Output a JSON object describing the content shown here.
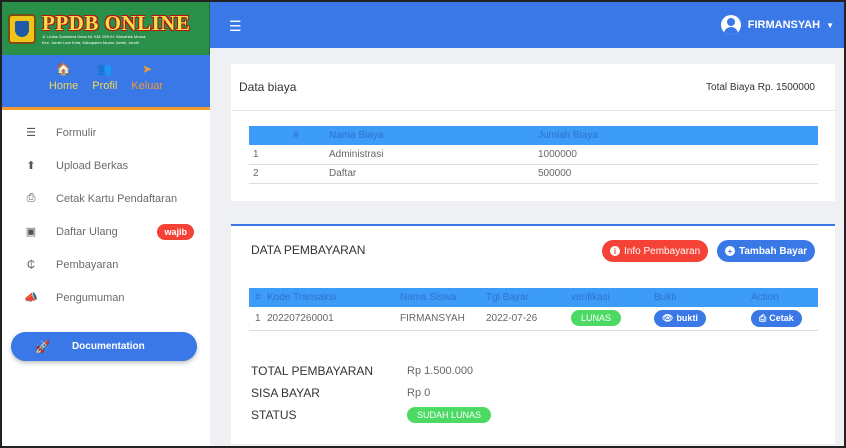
{
  "brand": {
    "title": "PPDB ONLINE",
    "subtitle_line1": "Jl. Lintas Sumatera Desa Nt. KM. 009 Kt. Wanahita Muara,",
    "subtitle_line2": "Kec. Jambi Luar Kota, Kabupaten Muaro Jambi, Jambi"
  },
  "userbar": {
    "home": "Home",
    "profil": "Profil",
    "keluar": "Keluar"
  },
  "sidebar": {
    "items": [
      {
        "label": "Formulir",
        "icon": "list-icon"
      },
      {
        "label": "Upload Berkas",
        "icon": "upload-icon"
      },
      {
        "label": "Cetak Kartu Pendaftaran",
        "icon": "print-icon"
      },
      {
        "label": "Daftar Ulang",
        "icon": "id-card-icon",
        "badge": "wajib"
      },
      {
        "label": "Pembayaran",
        "icon": "money-off-icon"
      },
      {
        "label": "Pengumuman",
        "icon": "megaphone-icon"
      }
    ],
    "documentation": "Documentation"
  },
  "topbar": {
    "username": "FIRMANSYAH"
  },
  "biaya": {
    "title": "Data biaya",
    "total": "Total Biaya Rp. 1500000",
    "headers": [
      "#",
      "Nama Biaya",
      "Jumlah Biaya"
    ],
    "rows": [
      [
        "1",
        "Administrasi",
        "1000000"
      ],
      [
        "2",
        "Daftar",
        "500000"
      ]
    ]
  },
  "pembayaran": {
    "title": "DATA PEMBAYARAN",
    "info_button": "Info Pembayaran",
    "add_button": "Tambah Bayar",
    "headers": [
      "#",
      "Kode Transaksi",
      "Nama Siswa",
      "Tgl Bayar",
      "verifikasi",
      "Bukti",
      "Action"
    ],
    "rows": [
      {
        "no": "1",
        "kode": "202207260001",
        "nama": "FIRMANSYAH",
        "tgl": "2022-07-26",
        "verifikasi": "LUNAS",
        "bukti": "bukti",
        "action": "Cetak"
      }
    ],
    "summary": {
      "total_label": "TOTAL PEMBAYARAN",
      "total_value": "Rp 1.500.000",
      "sisa_label": "SISA BAYAR",
      "sisa_value": "Rp 0",
      "status_label": "STATUS",
      "status_value": "SUDAH LUNAS"
    }
  },
  "colors": {
    "primary": "#3b78e7",
    "brand_green": "#2a8f49",
    "danger": "#f44336",
    "success": "#4cd964",
    "accent_orange": "#f29a2e"
  }
}
